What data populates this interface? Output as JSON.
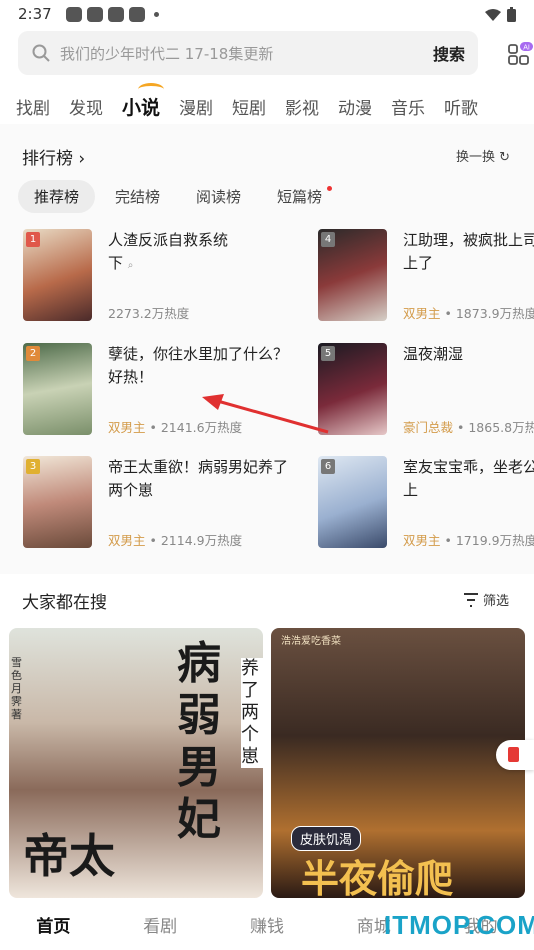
{
  "status_bar": {
    "time": "2:37"
  },
  "search": {
    "placeholder": "我们的少年时代二 17-18集更新",
    "button": "搜索"
  },
  "nav_tabs": [
    "找剧",
    "发现",
    "小说",
    "漫剧",
    "短剧",
    "影视",
    "动漫",
    "音乐",
    "听歌"
  ],
  "nav_active": "小说",
  "ranking": {
    "title": "排行榜",
    "swap_label": "换一换",
    "tabs": [
      "推荐榜",
      "完结榜",
      "阅读榜",
      "短篇榜"
    ],
    "books": [
      {
        "rank": "1",
        "title": "人渣反派自救系统",
        "title2": "下",
        "tag": "",
        "heat": "2273.2万热度"
      },
      {
        "rank": "2",
        "title": "孽徒，你往水里加了什么？好热！",
        "title2": "",
        "tag": "双男主",
        "heat": "2141.6万热度"
      },
      {
        "rank": "3",
        "title": "帝王太重欲！病弱男妃养了两个崽",
        "title2": "",
        "tag": "双男主",
        "heat": "2114.9万热度"
      },
      {
        "rank": "4",
        "title": "江助理，被疯批上司盯上了",
        "title2": "",
        "tag": "双男主",
        "heat": "1873.9万热度"
      },
      {
        "rank": "5",
        "title": "温夜潮湿",
        "title2": "",
        "tag": "豪门总裁",
        "heat": "1865.8万热度"
      },
      {
        "rank": "6",
        "title": "室友宝宝乖，坐老公腿上",
        "title2": "",
        "tag": "双男主",
        "heat": "1719.9万热度"
      }
    ]
  },
  "popular": {
    "title": "大家都在搜",
    "filter": "筛选",
    "cards": [
      {
        "cover_text": "病弱男妃",
        "side_text": "养了两个崽",
        "author": "雪色月霁 著",
        "corner": "帝太"
      },
      {
        "cover_text": "半夜偷爬",
        "banner": "皮肤饥渴",
        "author": "浩浩爱吃香菜"
      }
    ]
  },
  "bottom_tabs": [
    "首页",
    "看剧",
    "赚钱",
    "商城",
    "我的"
  ],
  "watermark": "ITMOP.COM",
  "colors": {
    "accent": "#f5a623",
    "tag": "#d39b4a",
    "watermark": "#1aa3c8",
    "arrow": "#e03030"
  }
}
